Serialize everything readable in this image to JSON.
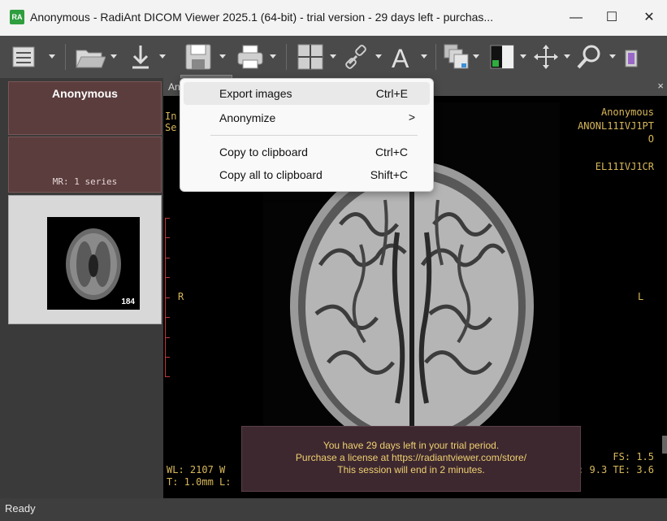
{
  "window": {
    "icon_text": "RA",
    "title": "Anonymous - RadiAnt DICOM Viewer 2025.1 (64-bit) - trial version - 29 days left - purchas...",
    "minimize": "—",
    "maximize": "☐",
    "close": "✕"
  },
  "toolbar": {
    "icons": [
      "database-icon",
      "open-folder-icon",
      "download-icon",
      "save-icon",
      "print-icon",
      "layout-grid-icon",
      "link-icon",
      "text-annotation-icon",
      "series-stack-icon",
      "window-level-icon",
      "pan-icon",
      "zoom-icon"
    ]
  },
  "left_panel": {
    "patient_name": "Anonymous",
    "study_info": "MR: 1 series",
    "series_image_count": "184"
  },
  "viewer": {
    "header_title": "An",
    "close": "×",
    "tl_line1": "In",
    "tl_line2": "Se",
    "tr_line1": "Anonymous",
    "tr_line2": "ANONL11IVJ1PT",
    "tr_line3": "O",
    "tr_line4": "EL11IVJ1CR",
    "orient_left": "R",
    "orient_right": "L",
    "bl_line1": "WL: 2107 W",
    "bl_line2": "T: 1.0mm L:",
    "br_line1": "FS: 1.5",
    "br_line2": ": 9.3 TE: 3.6"
  },
  "trial_notice": {
    "line1": "You have 29 days left in your trial period.",
    "line2": "Purchase a license at https://radiantviewer.com/store/",
    "line3": "This session will end in 2 minutes."
  },
  "context_menu": {
    "items": [
      {
        "label": "Export images",
        "shortcut": "Ctrl+E"
      },
      {
        "label": "Anonymize",
        "shortcut": ">"
      },
      {
        "label": "Copy to clipboard",
        "shortcut": "Ctrl+C"
      },
      {
        "label": "Copy all to clipboard",
        "shortcut": "Shift+C"
      }
    ]
  },
  "status": {
    "text": "Ready"
  }
}
